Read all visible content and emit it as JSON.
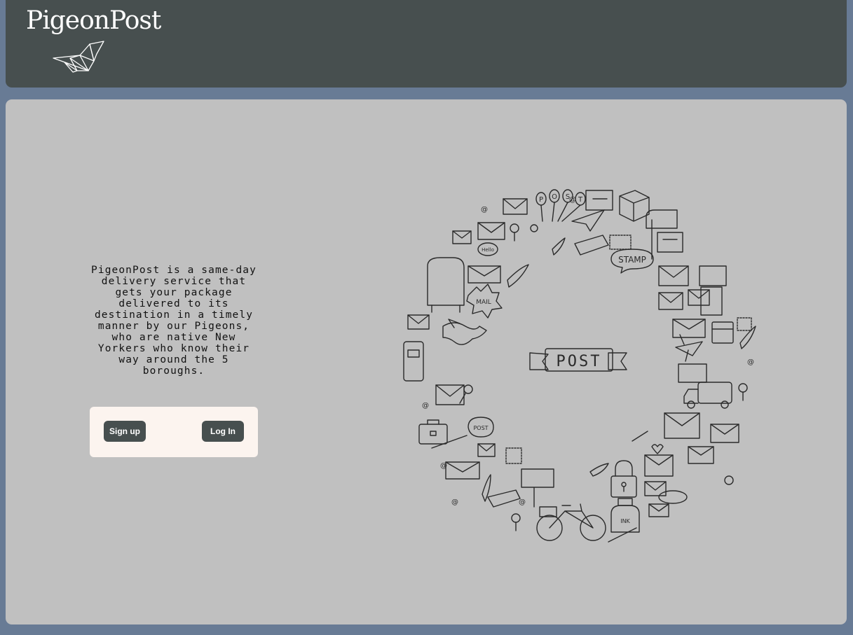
{
  "header": {
    "brand_title": "PigeonPost",
    "logo_icon": "origami-bird-icon"
  },
  "main": {
    "description": "PigeonPost is a same-day delivery service that gets your package delivered to its destination in a timely manner by our Pigeons, who are native New Yorkers who know their way around the 5 boroughs.",
    "auth": {
      "signup_label": "Sign up",
      "login_label": "Log In"
    },
    "illustration": {
      "banner_text": "POST",
      "balloon_letters": [
        "P",
        "O",
        "S",
        "T"
      ],
      "stamp_text": "STAMP",
      "mail_text": "MAIL",
      "hello_text": "Hello",
      "post_small_text": "POST",
      "ink_text": "INK"
    }
  },
  "colors": {
    "page_background": "#687b95",
    "header_background": "#474f4f",
    "panel_background": "#c0c0c0",
    "auth_box_background": "#fcf4ef",
    "button_background": "#474f4f"
  }
}
